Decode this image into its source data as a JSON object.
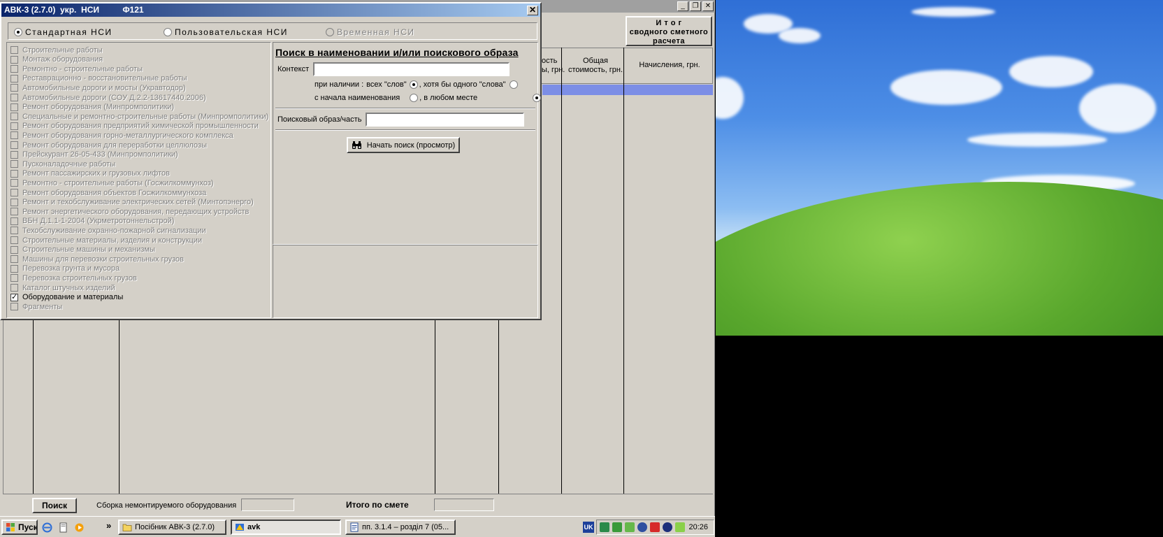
{
  "dialog": {
    "title": "АВК-3 (2.7.0)  укр.  НСИ          Ф121",
    "close_glyph": "✕",
    "nsi_options": [
      {
        "label": "Стандартная НСИ",
        "selected": true,
        "enabled": true
      },
      {
        "label": "Пользовательская НСИ",
        "selected": false,
        "enabled": true
      },
      {
        "label": "Временная НСИ",
        "selected": false,
        "enabled": false
      }
    ],
    "categories": [
      {
        "label": "Строительные работы",
        "checked": false
      },
      {
        "label": "Монтаж оборудования",
        "checked": false
      },
      {
        "label": "Ремонтно - строительные работы",
        "checked": false
      },
      {
        "label": "Реставрационно - восстановительные работы",
        "checked": false
      },
      {
        "label": "Автомобильные дороги и мосты (Укравтодор)",
        "checked": false
      },
      {
        "label": "Автомобильные дороги (СОУ Д.2.2-13617440.2006)",
        "checked": false
      },
      {
        "label": "Ремонт оборудования (Минпромполитики)",
        "checked": false
      },
      {
        "label": "Специальные и ремонтно-строительные работы (Минпромполитики)",
        "checked": false
      },
      {
        "label": "Ремонт оборудования предприятий химической промышленности",
        "checked": false
      },
      {
        "label": "Ремонт оборудования  горно-металлургического комплекса",
        "checked": false
      },
      {
        "label": "Ремонт оборудования для переработки целлюлозы",
        "checked": false
      },
      {
        "label": "Прейскурант 26-05-433 (Минпромполитики)",
        "checked": false
      },
      {
        "label": "Пусконаладочные работы",
        "checked": false
      },
      {
        "label": "Ремонт пассажирских и грузовых лифтов",
        "checked": false
      },
      {
        "label": "Ремонтно - строительные работы (Госжилкоммунхоз)",
        "checked": false
      },
      {
        "label": "Ремонт оборудования объектов Госжилкоммунхоза",
        "checked": false
      },
      {
        "label": "Ремонт и техобслуживание электрических сетей (Минтопэнерго)",
        "checked": false
      },
      {
        "label": "Ремонт энергетического оборудования, передающих устройств",
        "checked": false
      },
      {
        "label": "ВБН Д.1.1-1-2004 (Укрметротоннельстрой)",
        "checked": false
      },
      {
        "label": "Техобслуживание охранно-пожарной сигнализации",
        "checked": false
      },
      {
        "label": "Строительные материалы, изделия и конструкции",
        "checked": false
      },
      {
        "label": "Строительные машины и механизмы",
        "checked": false
      },
      {
        "label": "Машины для перевозки строительных грузов",
        "checked": false
      },
      {
        "label": "Перевозка грунта и мусора",
        "checked": false
      },
      {
        "label": "Перевозка строительных грузов",
        "checked": false
      },
      {
        "label": "Каталог штучных изделий",
        "checked": false
      },
      {
        "label": "Оборудование и материалы",
        "checked": true
      },
      {
        "label": "Фрагменты",
        "checked": false
      }
    ],
    "search": {
      "title": "Поиск в наименовании и/или поискового образа",
      "context_label": "Контекст",
      "context_value": "",
      "presence_label": "при наличии :",
      "all_words": "всех \"слов\"",
      "any_word": ", хотя бы одного \"слова\"",
      "from_start": "с начала наименования",
      "anywhere": ", в любом месте",
      "all_words_selected": true,
      "anywhere_selected": true,
      "pattern_label": "Поисковый образ/часть",
      "pattern_value": "",
      "start_button": "Начать поиск (просмотр)"
    }
  },
  "main": {
    "totals_button": "И т о г\nсводного сметного\nрасчета",
    "columns": [
      {
        "label": "ость\nы, грн."
      },
      {
        "label": "Общая\nстоимость, грн."
      },
      {
        "label": "Начисления, грн."
      }
    ],
    "search_button": "Поиск",
    "assembly_label": "Сборка немонтируемого оборудования",
    "total_label": "Итого по смете",
    "win_min": "_",
    "win_max": "❐",
    "win_close": "✕"
  },
  "taskbar": {
    "start": "Пуск",
    "chevron": "»",
    "tasks": [
      {
        "label": "Посібник АВК-3 (2.7.0)",
        "active": false
      },
      {
        "label": "avk",
        "active": true
      },
      {
        "label": "пп. 3.1.4 – розділ 7 (05...",
        "active": false
      }
    ],
    "lang": "UK",
    "clock": "20:26"
  },
  "colors": {
    "face": "#d4d0c8",
    "title_start": "#0a246a",
    "title_end": "#a6caf0",
    "selection": "#7c8ee6"
  }
}
